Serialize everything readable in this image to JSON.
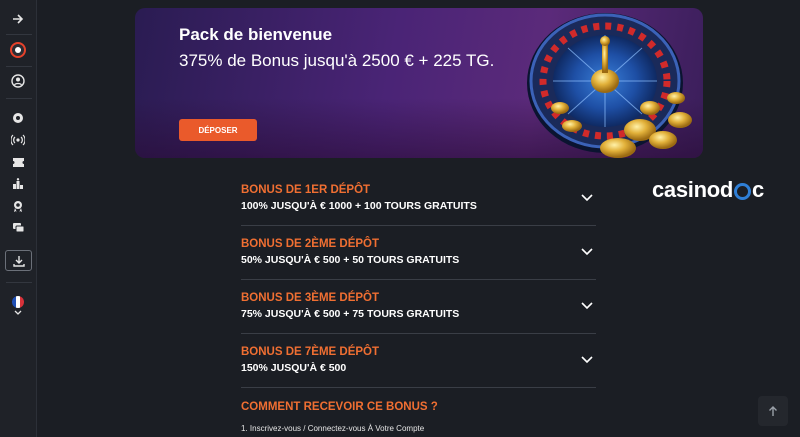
{
  "banner": {
    "title": "Pack de bienvenue",
    "subtitle": "375% de Bonus jusqu'à 2500 € + 225 TG.",
    "cta": "DÉPOSER"
  },
  "brand": {
    "pre": "casinod",
    "post": "c"
  },
  "bonuses": [
    {
      "title": "BONUS DE 1ER DÉPÔT",
      "desc": "100% JUSQU'À € 1000 + 100 TOURS GRATUITS"
    },
    {
      "title": "BONUS DE 2ÈME DÉPÔT",
      "desc": "50% JUSQU'À € 500 + 50 TOURS GRATUITS"
    },
    {
      "title": "BONUS DE 3ÈME DÉPÔT",
      "desc": "75% JUSQU'À € 500 + 75 TOURS GRATUITS"
    },
    {
      "title": "BONUS DE 7ÈME DÉPÔT",
      "desc": "150% JUSQU'À € 500"
    }
  ],
  "howto": {
    "heading": "COMMENT RECEVOIR CE BONUS ?",
    "step1": "1. Inscrivez-vous / Connectez-vous À Votre Compte"
  },
  "sidebar": {
    "icons": [
      "arrow-right-icon",
      "casino-logo-icon",
      "user-icon",
      "casino-chip-icon",
      "live-broadcast-icon",
      "ticket-icon",
      "leaderboard-icon",
      "award-icon",
      "chat-icon",
      "download-icon",
      "france-flag-icon",
      "chevron-down-icon"
    ]
  },
  "colors": {
    "accent": "#f06f32",
    "button": "#ea5a2b",
    "background": "#1b1e24"
  }
}
